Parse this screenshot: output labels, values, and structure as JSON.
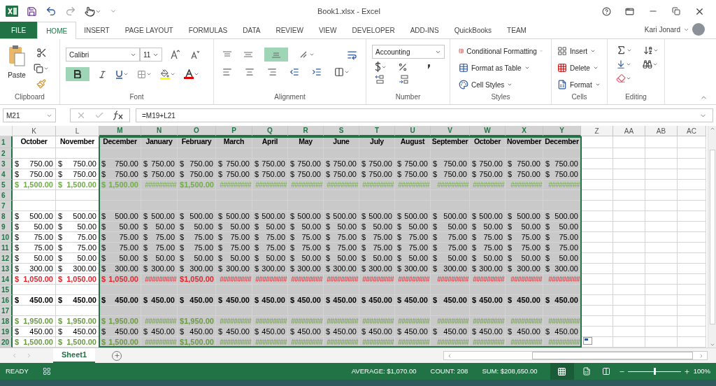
{
  "window": {
    "title": "Book1.xlsx - Excel"
  },
  "ribbon_tabs": [
    {
      "label": "FILE",
      "kind": "file",
      "selected": false
    },
    {
      "label": "HOME",
      "kind": "tab",
      "selected": true
    },
    {
      "label": "INSERT",
      "kind": "tab",
      "selected": false
    },
    {
      "label": "PAGE LAYOUT",
      "kind": "tab",
      "selected": false
    },
    {
      "label": "FORMULAS",
      "kind": "tab",
      "selected": false
    },
    {
      "label": "DATA",
      "kind": "tab",
      "selected": false
    },
    {
      "label": "REVIEW",
      "kind": "tab",
      "selected": false
    },
    {
      "label": "VIEW",
      "kind": "tab",
      "selected": false
    },
    {
      "label": "DEVELOPER",
      "kind": "tab",
      "selected": false
    },
    {
      "label": "ADD-INS",
      "kind": "tab",
      "selected": false
    },
    {
      "label": "QuickBooks",
      "kind": "tab",
      "selected": false
    },
    {
      "label": "TEAM",
      "kind": "tab",
      "selected": false
    }
  ],
  "user": {
    "name": "Kari Jonard"
  },
  "ribbon": {
    "clipboard": {
      "label": "Clipboard",
      "paste": "Paste"
    },
    "font": {
      "label": "Font",
      "name": "Calibri",
      "size": "11",
      "bold": true
    },
    "alignment": {
      "label": "Alignment",
      "middle_align": true
    },
    "number": {
      "label": "Number",
      "format": "Accounting"
    },
    "styles": {
      "label": "Styles",
      "items": [
        "Conditional Formatting",
        "Format as Table",
        "Cell Styles"
      ]
    },
    "cells": {
      "label": "Cells",
      "items": [
        "Insert",
        "Delete",
        "Format"
      ]
    },
    "editing": {
      "label": "Editing"
    }
  },
  "formula_bar": {
    "name_box": "M21",
    "formula": "=M19+L21"
  },
  "columns": [
    {
      "letter": "K",
      "selected": false
    },
    {
      "letter": "L",
      "selected": false
    },
    {
      "letter": "M",
      "selected": true
    },
    {
      "letter": "N",
      "selected": true
    },
    {
      "letter": "O",
      "selected": true
    },
    {
      "letter": "P",
      "selected": true
    },
    {
      "letter": "Q",
      "selected": true
    },
    {
      "letter": "R",
      "selected": true
    },
    {
      "letter": "S",
      "selected": true
    },
    {
      "letter": "T",
      "selected": true
    },
    {
      "letter": "U",
      "selected": true
    },
    {
      "letter": "V",
      "selected": true
    },
    {
      "letter": "W",
      "selected": true
    },
    {
      "letter": "X",
      "selected": true
    },
    {
      "letter": "Y",
      "selected": true
    },
    {
      "letter": "Z",
      "selected": false
    },
    {
      "letter": "AA",
      "selected": false
    },
    {
      "letter": "AB",
      "selected": false
    },
    {
      "letter": "AC",
      "selected": false
    }
  ],
  "rows": [
    {
      "number": "1",
      "kind": "heading",
      "cells": [
        "October",
        "November",
        "December",
        "January",
        "February",
        "March",
        "April",
        "May",
        "June",
        "July",
        "August",
        "September",
        "October",
        "November",
        "December"
      ]
    },
    {
      "number": "2",
      "kind": "plain",
      "cells": []
    },
    {
      "number": "3",
      "kind": "plain",
      "cells": [
        [
          "$",
          "750.00"
        ],
        [
          "$",
          "750.00"
        ],
        [
          "$",
          "750.00"
        ],
        [
          "$",
          "750.00"
        ],
        [
          "$",
          "750.00"
        ],
        [
          "$",
          "750.00"
        ],
        [
          "$",
          "750.00"
        ],
        [
          "$",
          "750.00"
        ],
        [
          "$",
          "750.00"
        ],
        [
          "$",
          "750.00"
        ],
        [
          "$",
          "750.00"
        ],
        [
          "$",
          "750.00"
        ],
        [
          "$",
          "750.00"
        ],
        [
          "$",
          "750.00"
        ],
        [
          "$",
          "750.00"
        ]
      ]
    },
    {
      "number": "4",
      "kind": "plain",
      "cells": [
        [
          "$",
          "750.00"
        ],
        [
          "$",
          "750.00"
        ],
        [
          "$",
          "750.00"
        ],
        [
          "$",
          "750.00"
        ],
        [
          "$",
          "750.00"
        ],
        [
          "$",
          "750.00"
        ],
        [
          "$",
          "750.00"
        ],
        [
          "$",
          "750.00"
        ],
        [
          "$",
          "750.00"
        ],
        [
          "$",
          "750.00"
        ],
        [
          "$",
          "750.00"
        ],
        [
          "$",
          "750.00"
        ],
        [
          "$",
          "750.00"
        ],
        [
          "$",
          "750.00"
        ],
        [
          "$",
          "750.00"
        ]
      ]
    },
    {
      "number": "5",
      "kind": "income_total",
      "cells": [
        [
          "$",
          "1,500.00"
        ],
        [
          "$",
          "1,500.00"
        ],
        [
          "$",
          "1,500.00"
        ],
        "#########",
        [
          "$",
          "1,500.00"
        ],
        "#########",
        "#########",
        "#########",
        "#########",
        "#########",
        "#########",
        "#########",
        "#########",
        "#########",
        "#########"
      ]
    },
    {
      "number": "6",
      "kind": "plain",
      "cells": []
    },
    {
      "number": "7",
      "kind": "plain",
      "cells": []
    },
    {
      "number": "8",
      "kind": "plain",
      "cells": [
        [
          "$",
          "500.00"
        ],
        [
          "$",
          "500.00"
        ],
        [
          "$",
          "500.00"
        ],
        [
          "$",
          "500.00"
        ],
        [
          "$",
          "500.00"
        ],
        [
          "$",
          "500.00"
        ],
        [
          "$",
          "500.00"
        ],
        [
          "$",
          "500.00"
        ],
        [
          "$",
          "500.00"
        ],
        [
          "$",
          "500.00"
        ],
        [
          "$",
          "500.00"
        ],
        [
          "$",
          "500.00"
        ],
        [
          "$",
          "500.00"
        ],
        [
          "$",
          "500.00"
        ],
        [
          "$",
          "500.00"
        ]
      ]
    },
    {
      "number": "9",
      "kind": "plain",
      "cells": [
        [
          "$",
          "50.00"
        ],
        [
          "$",
          "50.00"
        ],
        [
          "$",
          "50.00"
        ],
        [
          "$",
          "50.00"
        ],
        [
          "$",
          "50.00"
        ],
        [
          "$",
          "50.00"
        ],
        [
          "$",
          "50.00"
        ],
        [
          "$",
          "50.00"
        ],
        [
          "$",
          "50.00"
        ],
        [
          "$",
          "50.00"
        ],
        [
          "$",
          "50.00"
        ],
        [
          "$",
          "50.00"
        ],
        [
          "$",
          "50.00"
        ],
        [
          "$",
          "50.00"
        ],
        [
          "$",
          "50.00"
        ]
      ]
    },
    {
      "number": "10",
      "kind": "plain",
      "cells": [
        [
          "$",
          "75.00"
        ],
        [
          "$",
          "75.00"
        ],
        [
          "$",
          "75.00"
        ],
        [
          "$",
          "75.00"
        ],
        [
          "$",
          "75.00"
        ],
        [
          "$",
          "75.00"
        ],
        [
          "$",
          "75.00"
        ],
        [
          "$",
          "75.00"
        ],
        [
          "$",
          "75.00"
        ],
        [
          "$",
          "75.00"
        ],
        [
          "$",
          "75.00"
        ],
        [
          "$",
          "75.00"
        ],
        [
          "$",
          "75.00"
        ],
        [
          "$",
          "75.00"
        ],
        [
          "$",
          "75.00"
        ]
      ]
    },
    {
      "number": "11",
      "kind": "plain",
      "cells": [
        [
          "$",
          "75.00"
        ],
        [
          "$",
          "75.00"
        ],
        [
          "$",
          "75.00"
        ],
        [
          "$",
          "75.00"
        ],
        [
          "$",
          "75.00"
        ],
        [
          "$",
          "75.00"
        ],
        [
          "$",
          "75.00"
        ],
        [
          "$",
          "75.00"
        ],
        [
          "$",
          "75.00"
        ],
        [
          "$",
          "75.00"
        ],
        [
          "$",
          "75.00"
        ],
        [
          "$",
          "75.00"
        ],
        [
          "$",
          "75.00"
        ],
        [
          "$",
          "75.00"
        ],
        [
          "$",
          "75.00"
        ]
      ]
    },
    {
      "number": "12",
      "kind": "plain",
      "cells": [
        [
          "$",
          "50.00"
        ],
        [
          "$",
          "50.00"
        ],
        [
          "$",
          "50.00"
        ],
        [
          "$",
          "50.00"
        ],
        [
          "$",
          "50.00"
        ],
        [
          "$",
          "50.00"
        ],
        [
          "$",
          "50.00"
        ],
        [
          "$",
          "50.00"
        ],
        [
          "$",
          "50.00"
        ],
        [
          "$",
          "50.00"
        ],
        [
          "$",
          "50.00"
        ],
        [
          "$",
          "50.00"
        ],
        [
          "$",
          "50.00"
        ],
        [
          "$",
          "50.00"
        ],
        [
          "$",
          "50.00"
        ]
      ]
    },
    {
      "number": "13",
      "kind": "plain",
      "cells": [
        [
          "$",
          "300.00"
        ],
        [
          "$",
          "300.00"
        ],
        [
          "$",
          "300.00"
        ],
        [
          "$",
          "300.00"
        ],
        [
          "$",
          "300.00"
        ],
        [
          "$",
          "300.00"
        ],
        [
          "$",
          "300.00"
        ],
        [
          "$",
          "300.00"
        ],
        [
          "$",
          "300.00"
        ],
        [
          "$",
          "300.00"
        ],
        [
          "$",
          "300.00"
        ],
        [
          "$",
          "300.00"
        ],
        [
          "$",
          "300.00"
        ],
        [
          "$",
          "300.00"
        ],
        [
          "$",
          "300.00"
        ]
      ]
    },
    {
      "number": "14",
      "kind": "expense_total",
      "cells": [
        [
          "$",
          "1,050.00"
        ],
        [
          "$",
          "1,050.00"
        ],
        [
          "$",
          "1,050.00"
        ],
        "#########",
        [
          "$",
          "1,050.00"
        ],
        "#########",
        "#########",
        "#########",
        "#########",
        "#########",
        "#########",
        "#########",
        "#########",
        "#########",
        "#########"
      ]
    },
    {
      "number": "15",
      "kind": "plain",
      "cells": []
    },
    {
      "number": "16",
      "kind": "net",
      "cells": [
        [
          "$",
          "450.00"
        ],
        [
          "$",
          "450.00"
        ],
        [
          "$",
          "450.00"
        ],
        [
          "$",
          "450.00"
        ],
        [
          "$",
          "450.00"
        ],
        [
          "$",
          "450.00"
        ],
        [
          "$",
          "450.00"
        ],
        [
          "$",
          "450.00"
        ],
        [
          "$",
          "450.00"
        ],
        [
          "$",
          "450.00"
        ],
        [
          "$",
          "450.00"
        ],
        [
          "$",
          "450.00"
        ],
        [
          "$",
          "450.00"
        ],
        [
          "$",
          "450.00"
        ],
        [
          "$",
          "450.00"
        ]
      ]
    },
    {
      "number": "17",
      "kind": "plain",
      "cells": []
    },
    {
      "number": "18",
      "kind": "balance",
      "cells": [
        [
          "$",
          "1,950.00"
        ],
        [
          "$",
          "1,950.00"
        ],
        [
          "$",
          "1,950.00"
        ],
        "#########",
        [
          "$",
          "1,950.00"
        ],
        "#########",
        "#########",
        "#########",
        "#########",
        "#########",
        "#########",
        "#########",
        "#########",
        "#########",
        "#########"
      ]
    },
    {
      "number": "19",
      "kind": "plain",
      "cells": [
        [
          "$",
          "450.00"
        ],
        [
          "$",
          "450.00"
        ],
        [
          "$",
          "450.00"
        ],
        [
          "$",
          "450.00"
        ],
        [
          "$",
          "450.00"
        ],
        [
          "$",
          "450.00"
        ],
        [
          "$",
          "450.00"
        ],
        [
          "$",
          "450.00"
        ],
        [
          "$",
          "450.00"
        ],
        [
          "$",
          "450.00"
        ],
        [
          "$",
          "450.00"
        ],
        [
          "$",
          "450.00"
        ],
        [
          "$",
          "450.00"
        ],
        [
          "$",
          "450.00"
        ],
        [
          "$",
          "450.00"
        ]
      ]
    },
    {
      "number": "20",
      "kind": "balance",
      "cells": [
        [
          "$",
          "1,500.00"
        ],
        [
          "$",
          "1,500.00"
        ],
        [
          "$",
          "1,500.00"
        ],
        "#########",
        [
          "$",
          "1,500.00"
        ],
        "#########",
        "#########",
        "#########",
        "#########",
        "#########",
        "#########",
        "#########",
        "#########",
        "#########",
        "#########"
      ]
    }
  ],
  "sheet_tabs": [
    {
      "label": "Sheet1",
      "selected": true
    }
  ],
  "status_bar": {
    "mode": "READY",
    "average": "AVERAGE: $1,070.00",
    "count": "COUNT: 208",
    "sum": "SUM: $208,650.00",
    "zoom": {
      "level": 0.5,
      "label": "100%"
    }
  }
}
